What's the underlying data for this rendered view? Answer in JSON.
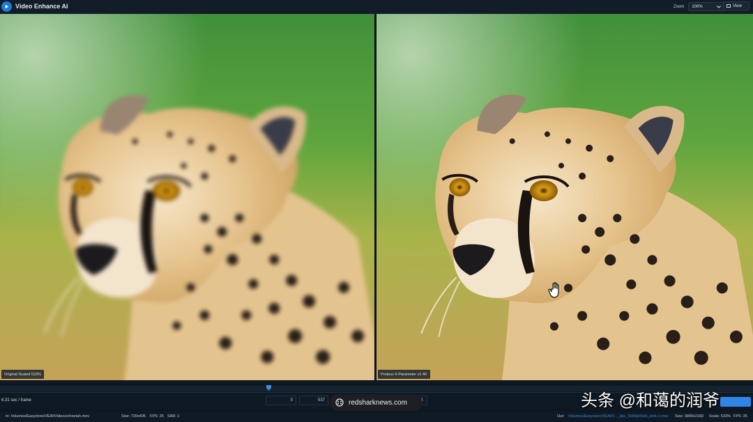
{
  "app": {
    "title": "Video Enhance AI",
    "accent": "#1a7cd6"
  },
  "toolbar": {
    "zoom_label": "Zoom",
    "zoom_value": "100%",
    "view_label": "View"
  },
  "preview": {
    "left_label": "Original Scaled 533%",
    "right_label": "Proteus 6-Parameter v1 4K"
  },
  "timeline": {
    "frame_time": "6.31 sec / frame",
    "start_frame": "0",
    "end_frame": "537",
    "extra_field": "11",
    "playhead_position": 0.357
  },
  "status": {
    "in_path": "In:  Volumes/Easystore/VEAI/Videos/cheetah.mov",
    "in_size": "Size: 720x405",
    "in_fps": "FPS: 25",
    "in_sar": "SAR: 1",
    "out_label": "Out:",
    "out_file": "Volumes/Easystore/VEAI/V..._2pL_6000p01bd_amk-1.mov",
    "out_size": "Size: 3840x2160",
    "out_scale": "Scale: 533%",
    "out_fps": "FPS: 25"
  },
  "overlay": {
    "watermark": "redsharknews.com",
    "caption": "头条 @和蔼的润爷"
  },
  "icons": [
    "app-logo-icon",
    "chevron-down-icon",
    "view-icon",
    "playhead-marker-icon",
    "hand-cursor-icon",
    "globe-icon"
  ]
}
